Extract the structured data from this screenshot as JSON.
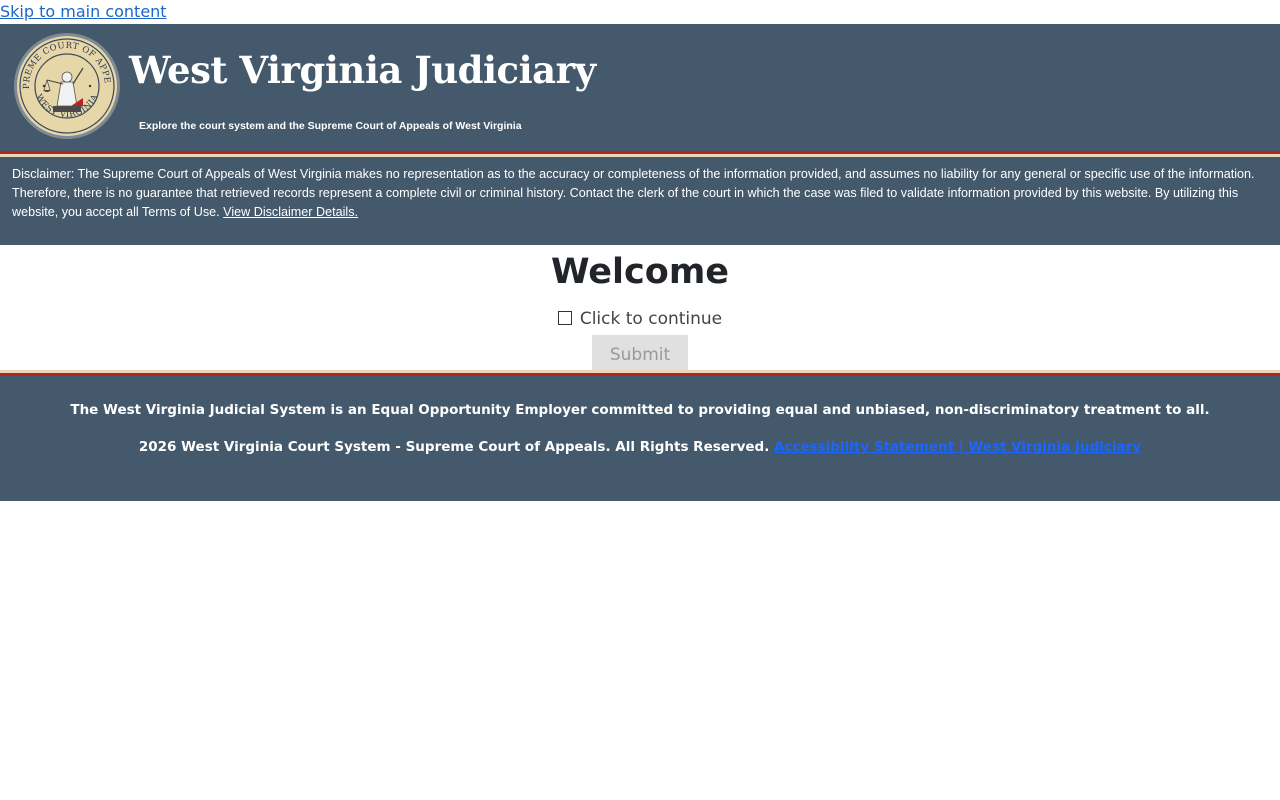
{
  "skip_link": "Skip to main content",
  "header": {
    "title": "West Virginia Judiciary",
    "subtitle": "Explore the court system and the Supreme Court of Appeals of West Virginia",
    "seal": {
      "top_text": "SUPREME COURT OF APPEALS",
      "bottom_text": "WEST VIRGINIA"
    }
  },
  "disclaimer": {
    "text": "Disclaimer: The Supreme Court of Appeals of West Virginia makes no representation as to the accuracy or completeness of the information provided, and assumes no liability for any general or specific use of the information. Therefore, there is no guarantee that retrieved records represent a complete civil or criminal history. Contact the clerk of the court in which the case was filed to validate information provided by this website. By utilizing this website, you accept all Terms of Use.",
    "link": "View Disclaimer Details."
  },
  "main": {
    "heading": "Welcome",
    "checkbox_label": "Click to continue",
    "submit_label": "Submit"
  },
  "footer": {
    "eeo": "The West Virginia Judicial System is an Equal Opportunity Employer committed to providing equal and unbiased, non-discriminatory treatment to all.",
    "copyright": "2026 West Virginia Court System - Supreme Court of Appeals. All Rights Reserved.",
    "link_accessibility": "Accessibility Statement",
    "link_separator": "|",
    "link_judiciary": "West Virginia Judiciary"
  },
  "colors": {
    "header_bg": "#44596c",
    "stripe_red": "#b52423",
    "stripe_tan": "#e8d8b8",
    "link_blue": "#1a66ff"
  }
}
